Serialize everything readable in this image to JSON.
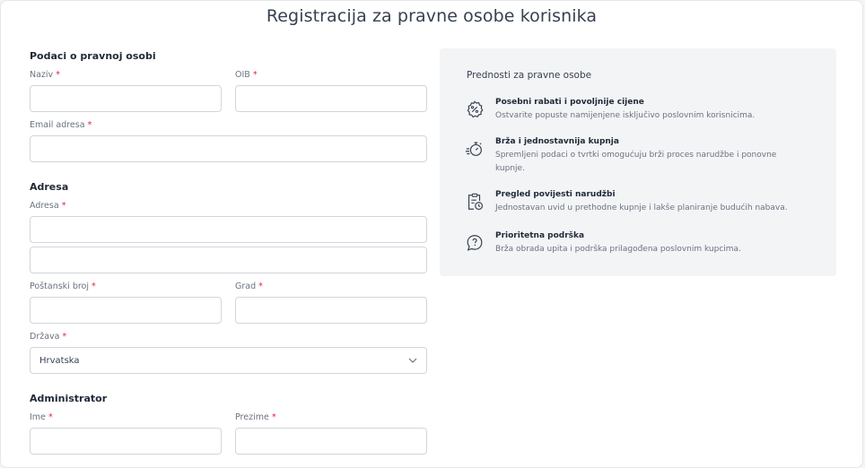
{
  "page": {
    "title": "Registracija za pravne osobe korisnika"
  },
  "company": {
    "section_title": "Podaci o pravnoj osobi",
    "name_label": "Naziv",
    "oib_label": "OIB",
    "email_label": "Email adresa",
    "required_mark": "*"
  },
  "address": {
    "section_title": "Adresa",
    "address_label": "Adresa",
    "postal_label": "Poštanski broj",
    "city_label": "Grad",
    "country_label": "Država",
    "country_value": "Hrvatska"
  },
  "admin": {
    "section_title": "Administrator",
    "first_name_label": "Ime",
    "last_name_label": "Prezime"
  },
  "benefits": {
    "title": "Prednosti za pravne osobe",
    "items": [
      {
        "icon": "discount-badge-icon",
        "title": "Posebni rabati i povoljnije cijene",
        "desc": "Ostvarite popuste namijenjene isključivo poslovnim korisnicima."
      },
      {
        "icon": "fast-stopwatch-icon",
        "title": "Brža i jednostavnija kupnja",
        "desc": "Spremljeni podaci o tvrtki omogućuju brži proces narudžbe i ponovne kupnje."
      },
      {
        "icon": "order-history-icon",
        "title": "Pregled povijesti narudžbi",
        "desc": "Jednostavan uvid u prethodne kupnje i lakše planiranje budućih nabava."
      },
      {
        "icon": "support-question-icon",
        "title": "Prioritetna podrška",
        "desc": "Brža obrada upita i podrška prilagođena poslovnim kupcima."
      }
    ]
  },
  "colors": {
    "required": "#e11d48",
    "panel_bg": "#f3f4f6",
    "icon": "#374151"
  }
}
